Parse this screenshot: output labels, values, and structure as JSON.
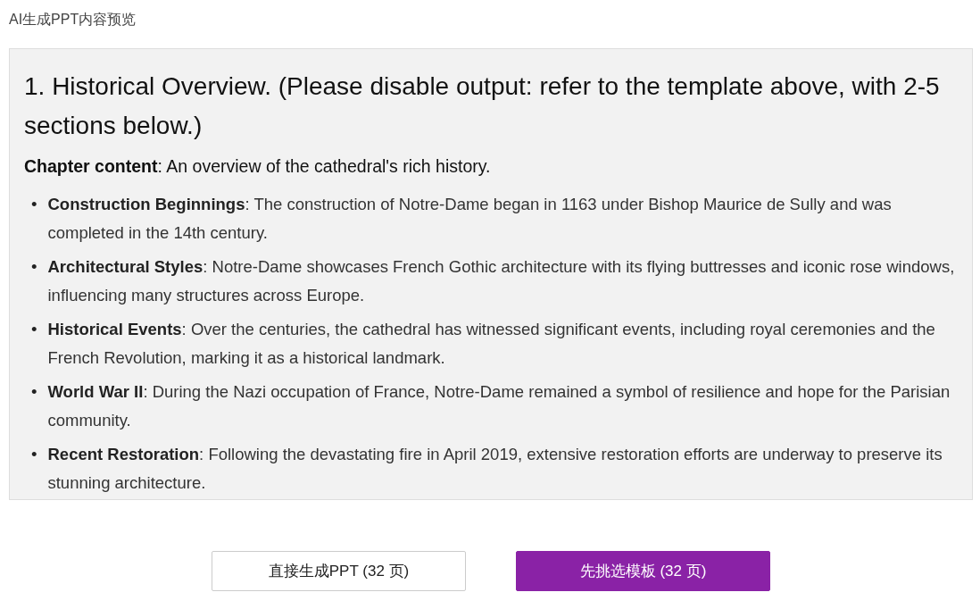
{
  "title": "AI生成PPT内容预览",
  "preview": {
    "heading": "1. Historical Overview. (Please disable output: refer to the template above, with 2-5 sections below.)",
    "summary": "**Chapter content**: An overview of the cathedral's rich history.",
    "items": [
      {
        "marker": "•",
        "text": "**Construction Beginnings**: The construction of Notre-Dame began in 1163 under Bishop Maurice de Sully and was completed in the 14th century."
      },
      {
        "marker": "•",
        "text": "**Architectural Styles**: Notre-Dame showcases French Gothic architecture with its flying buttresses and iconic rose windows, influencing many structures across Europe."
      },
      {
        "marker": "•",
        "text": "**Historical Events**: Over the centuries, the cathedral has witnessed significant events, including royal ceremonies and the French Revolution, marking it as a historical landmark."
      },
      {
        "marker": "•",
        "text": "**World War II**: During the Nazi occupation of France, Notre-Dame remained a symbol of resilience and hope for the Parisian community."
      },
      {
        "marker": "•",
        "text": "**Recent Restoration**: Following the devastating fire in April 2019, extensive restoration efforts are underway to preserve its stunning architecture."
      }
    ]
  },
  "buttons": [
    {
      "label": "直接生成PPT (32 页)",
      "kind": "secondary"
    },
    {
      "label": "先挑选模板 (32 页)",
      "kind": "primary"
    }
  ]
}
